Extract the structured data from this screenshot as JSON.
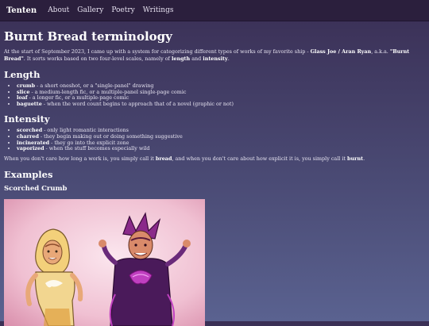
{
  "nav": {
    "brand": "Tenten",
    "links": [
      "About",
      "Gallery",
      "Poetry",
      "Writings"
    ]
  },
  "page_title": "Burnt Bread terminology",
  "intro": {
    "t1": "At the start of September 2023, I came up with a system for categorizing different types of works of my favorite ship - ",
    "ship": "Glass Joe / Aran Ryan",
    "t2": ", a.k.a. ",
    "nickname": "\"Burnt Bread\"",
    "t3": ". It sorts works based on two four-level scales, namely of ",
    "scale1": "length",
    "t4": " and ",
    "scale2": "intensity",
    "t5": "."
  },
  "length": {
    "heading": "Length",
    "items": [
      {
        "term": "crumb",
        "desc": " - a short oneshot, or a \"single-panel\" drawing"
      },
      {
        "term": "slice",
        "desc": " - a medium-length fic, or a multiple-panel single-page comic"
      },
      {
        "term": "loaf",
        "desc": " - a longer fic, or a multiple-page comic"
      },
      {
        "term": "baguette",
        "desc": " - when the word count begins to approach that of a novel (graphic or not)"
      }
    ]
  },
  "intensity": {
    "heading": "Intensity",
    "items": [
      {
        "term": "scorched",
        "desc": " - only light romantic interactions"
      },
      {
        "term": "charred",
        "desc": " - they begin making out or doing something suggestive"
      },
      {
        "term": "incinerated",
        "desc": " - they go into the explicit zone"
      },
      {
        "term": "vaporized",
        "desc": " - when the stuff becomes especially wild"
      }
    ]
  },
  "summary": {
    "t1": "When you don't care how long a work is, you simply call it ",
    "w1": "bread",
    "t2": ", and when you don't care about how explicit it is, you simply call it ",
    "w2": "burnt",
    "t3": "."
  },
  "examples": {
    "heading": "Examples",
    "first_title": "Scorched Crumb"
  },
  "colors": {
    "nav_bg": "#2b1f3d",
    "page_bg_top": "#3a2f55",
    "page_bg_bottom": "#5a6290"
  }
}
